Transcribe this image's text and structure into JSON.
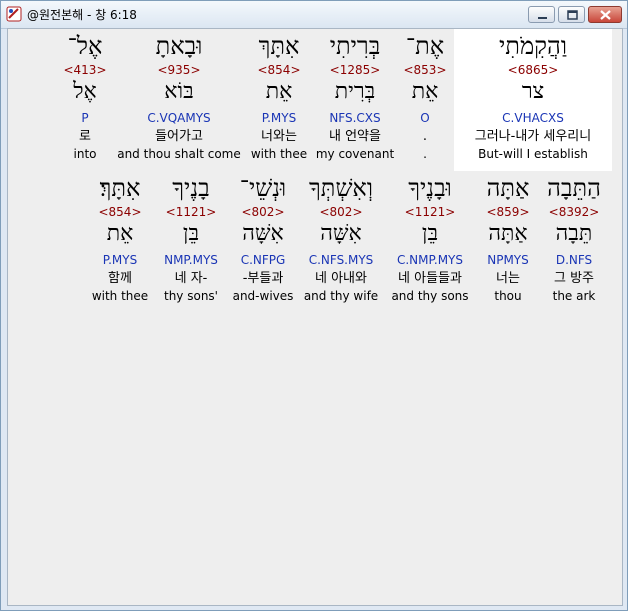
{
  "window": {
    "title": "@원전본해 - 창 6:18"
  },
  "row1": [
    {
      "hebrew": "וַהֲקִמֹתִי",
      "strongs": "<6865>",
      "lemma": "צר",
      "parse": "C.VHACXS",
      "korean": "그러나-내가 세우리니",
      "english": "But-will I establish",
      "selected": true
    },
    {
      "hebrew": "אֶת־",
      "strongs": "<853>",
      "lemma": "אֵת",
      "parse": "O",
      "korean": ".",
      "english": "."
    },
    {
      "hebrew": "בְּרִיתִי",
      "strongs": "<1285>",
      "lemma": "בְּרִית",
      "parse": "NFS.CXS",
      "korean": "내 언약을",
      "english": "my covenant"
    },
    {
      "hebrew": "אִתָּךְ",
      "strongs": "<854>",
      "lemma": "אֵת",
      "parse": "P.MYS",
      "korean": "너와는",
      "english": "with thee"
    },
    {
      "hebrew": "וּבָאתָ",
      "strongs": "<935>",
      "lemma": "בּוֹא",
      "parse": "C.VQAMYS",
      "korean": "들어가고",
      "english": "and thou shalt come"
    },
    {
      "hebrew": "אֶל־",
      "strongs": "<413>",
      "lemma": "אֶל",
      "parse": "P",
      "korean": "로",
      "english": "into"
    }
  ],
  "row2": [
    {
      "hebrew": "הַתֵּבָה",
      "strongs": "<8392>",
      "lemma": "תֵּבָה",
      "parse": "D.NFS",
      "korean": "그 방주",
      "english": "the ark"
    },
    {
      "hebrew": "אַתָּה",
      "strongs": "<859>",
      "lemma": "אַתָּה",
      "parse": "NPMYS",
      "korean": "너는",
      "english": "thou"
    },
    {
      "hebrew": "וּבָנֶיךָ",
      "strongs": "<1121>",
      "lemma": "בֵּן",
      "parse": "C.NMP.MYS",
      "korean": "네 아들들과",
      "english": "and thy sons"
    },
    {
      "hebrew": "וְאִשְׁתְּךָ",
      "strongs": "<802>",
      "lemma": "אִשָּׁה",
      "parse": "C.NFS.MYS",
      "korean": "네 아내와",
      "english": "and thy wife"
    },
    {
      "hebrew": "וּנְשֵׁי־",
      "strongs": "<802>",
      "lemma": "אִשָּׁה",
      "parse": "C.NFPG",
      "korean": "-부들과",
      "english": "and-wives"
    },
    {
      "hebrew": "בָנֶיךָ",
      "strongs": "<1121>",
      "lemma": "בֵּן",
      "parse": "NMP.MYS",
      "korean": "네 자-",
      "english": "thy sons'"
    },
    {
      "hebrew": "אִתָּךְ׃",
      "strongs": "<854>",
      "lemma": "אֵת",
      "parse": "P.MYS",
      "korean": "함께",
      "english": "with thee"
    }
  ]
}
